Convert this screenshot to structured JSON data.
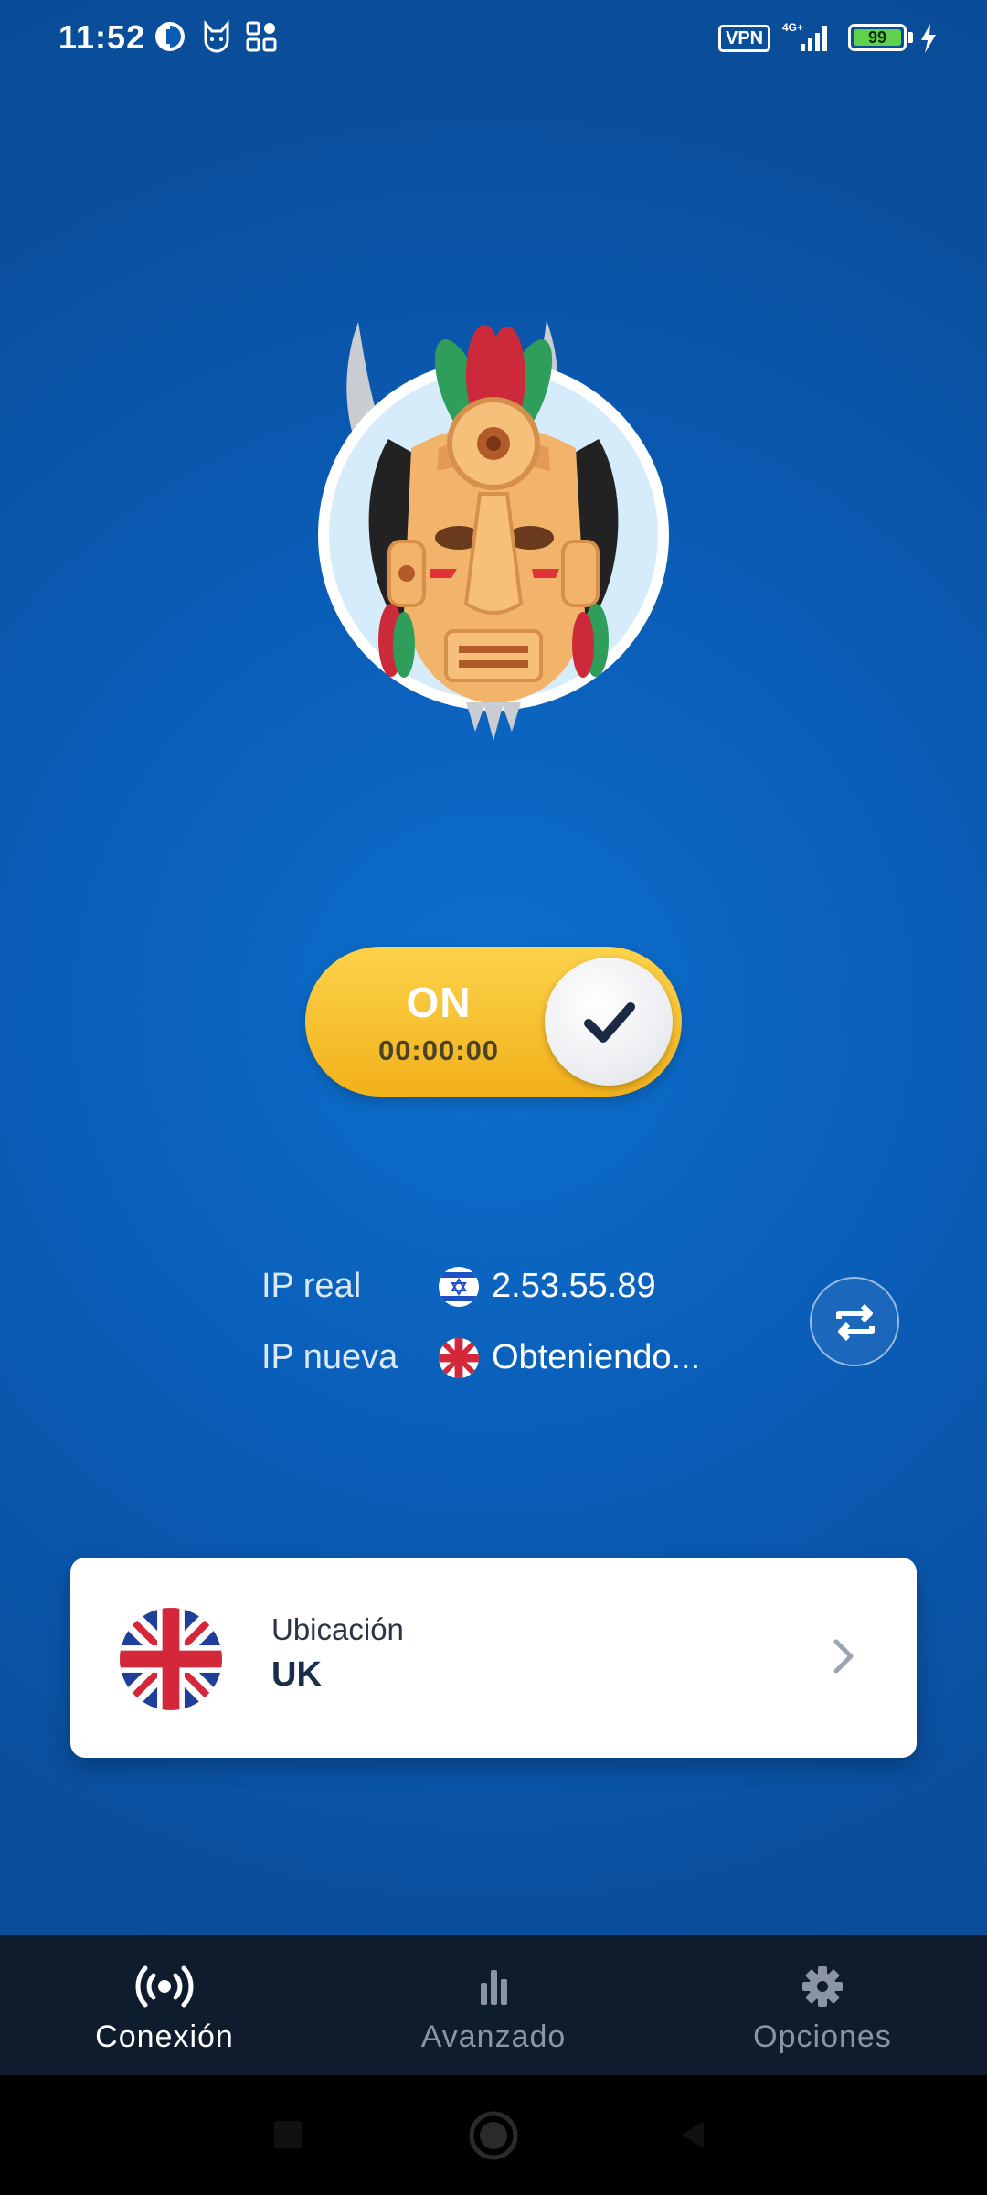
{
  "status_bar": {
    "time": "11:52",
    "vpn_badge": "VPN",
    "network": "4G+",
    "battery": "99"
  },
  "connection": {
    "state": "ON",
    "timer": "00:00:00"
  },
  "ip_info": {
    "real_label": "IP real",
    "real_value": "2.53.55.89",
    "new_label": "IP nueva",
    "new_value": "Obteniendo..."
  },
  "location": {
    "label": "Ubicación",
    "value": "UK"
  },
  "nav": {
    "items": [
      {
        "label": "Conexión",
        "icon": "broadcast-icon",
        "active": true
      },
      {
        "label": "Avanzado",
        "icon": "bar-chart-icon",
        "active": false
      },
      {
        "label": "Opciones",
        "icon": "gear-icon",
        "active": false
      }
    ]
  },
  "colors": {
    "background": "#0a5cb6",
    "toggle": "#f5bd25",
    "nav_bg": "#0f1c2e",
    "nav_active": "#ffffff",
    "nav_inactive": "#8a94a3"
  }
}
